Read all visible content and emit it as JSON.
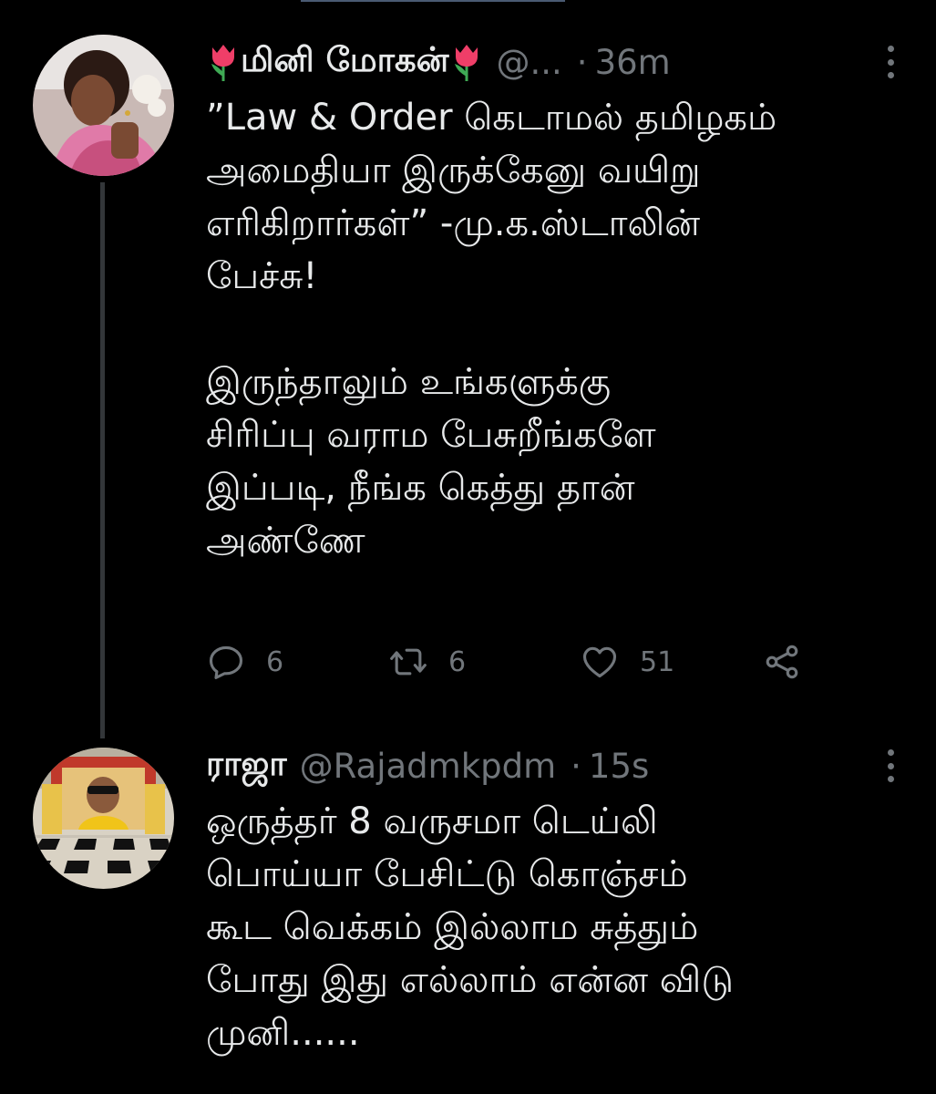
{
  "colors": {
    "background": "#000000",
    "text": "#e7e9ea",
    "muted": "#71767b",
    "thread_line": "#333639"
  },
  "tweets": [
    {
      "display_name": "மினி மோகன்",
      "name_emoji": "tulip",
      "handle": "@...",
      "separator": "·",
      "time": "36m",
      "lines": [
        "”Law & Order கெடாமல் தமிழகம்",
        "அமைதியா இருக்கேனு வயிறு",
        "எரிகிறார்கள்” -மு.க.ஸ்டாலின்",
        "பேச்சு!",
        "",
        "இருந்தாலும் உங்களுக்கு",
        "சிரிப்பு வராம பேசுறீங்களே",
        "இப்படி, நீங்க கெத்து தான்",
        "அண்ணே"
      ],
      "actions": {
        "reply_count": "6",
        "retweet_count": "6",
        "like_count": "51"
      },
      "icons": [
        "reply-icon",
        "retweet-icon",
        "like-icon",
        "share-icon",
        "more-icon"
      ]
    },
    {
      "display_name": "ராஜா",
      "handle": "@Rajadmkpdm",
      "separator": "·",
      "time": "15s",
      "lines": [
        "ஒருத்தர் 8 வருசமா டெய்லி",
        "பொய்யா பேசிட்டு கொஞ்சம்",
        "கூட வெக்கம் இல்லாம சுத்தும்",
        "போது இது எல்லாம் என்ன விடு",
        "முனி......"
      ],
      "icons": [
        "more-icon"
      ]
    }
  ]
}
